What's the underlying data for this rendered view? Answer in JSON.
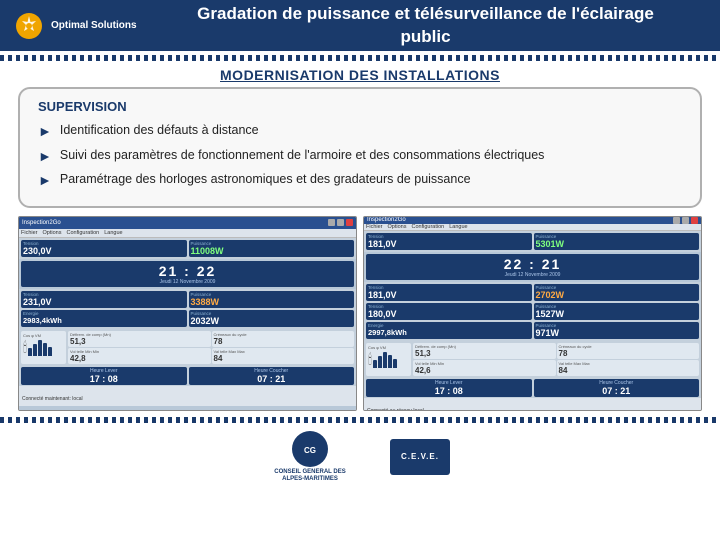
{
  "header": {
    "logo_company": "Optimal Solutions",
    "title_line1": "Gradation de puissance et télésurveillance de l'éclairage",
    "title_line2": "public",
    "title_full": "Gradation de puissance et télésurveillance de l'éclairage public"
  },
  "section": {
    "title": "MODERNISATION DES INSTALLATIONS",
    "supervision_label": "SUPERVISION",
    "bullets": [
      "Identification des défauts à distance",
      "Suivi des paramètres de fonctionnement de l'armoire et des consommations électriques",
      "Paramétrage des horloges astronomiques et des gradateurs de puissance"
    ]
  },
  "screen1": {
    "title": "Inspection2Go",
    "time": "21 : 22",
    "date": "Jeudi 12 Novembre 2009",
    "cells": [
      {
        "label": "Tension",
        "value": "230,0V"
      },
      {
        "label": "Puissance",
        "value": "11008W"
      },
      {
        "label": "Tension",
        "value": "231,0V"
      },
      {
        "label": "Puissance",
        "value": "3388W"
      },
      {
        "label": "Energie",
        "value": "2983,4kWh"
      },
      {
        "label": "Puissance",
        "value": "2032W"
      }
    ],
    "status": "Connecté maintenant: local"
  },
  "screen2": {
    "title": "Inspection2Go",
    "time": "22 : 21",
    "date": "Jeudi 12 Novembre 2009",
    "cells": [
      {
        "label": "Tension",
        "value": "181,0V"
      },
      {
        "label": "Puissance",
        "value": "5301W"
      },
      {
        "label": "Tension",
        "value": "181,0V"
      },
      {
        "label": "Puissance",
        "value": "2702W"
      },
      {
        "label": "Tension",
        "value": "180,0V"
      },
      {
        "label": "Puissance",
        "value": "1527W"
      },
      {
        "label": "Energie",
        "value": "2997,8kWh"
      },
      {
        "label": "Puissance",
        "value": "971W"
      }
    ],
    "status": "Connecté au réseau local"
  },
  "footer": {
    "logo1_text": "CONSEIL GENERAL\nDES ALPES-MARITIMES",
    "logo2_text": "C.E.V.E."
  }
}
